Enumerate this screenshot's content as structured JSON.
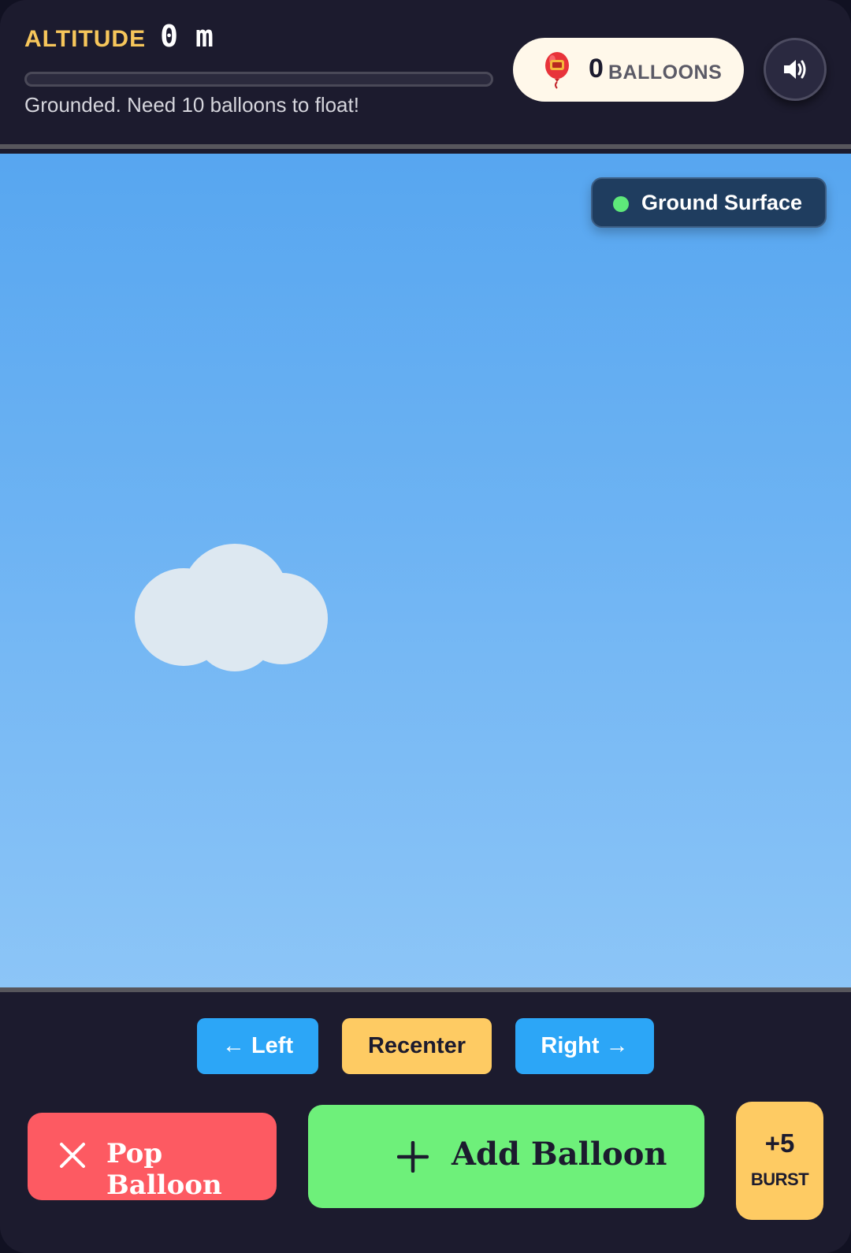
{
  "header": {
    "altitude_label": "ALTITUDE",
    "altitude_value": "0",
    "altitude_unit": "m",
    "altitude_progress": 0,
    "status_text": "Grounded. Need 10 balloons to float!",
    "balloon_count": "0",
    "balloon_count_label": "BALLOONS",
    "balloon_icon": "balloon-icon",
    "sound_icon": "speaker-icon"
  },
  "scene": {
    "zone_label": "Ground Surface",
    "zone_indicator_color": "#5ee87a"
  },
  "controls": {
    "left_label": "← Left",
    "recenter_label": "Recenter",
    "right_label": "Right →",
    "pop_label": "Pop Balloon",
    "add_label": "Add Balloon",
    "burst_amount": "+5",
    "burst_label": "BURST"
  },
  "colors": {
    "accent_gold": "#f6c65b",
    "button_blue": "#2ca6f7",
    "button_yellow": "#fecb63",
    "button_red": "#fd5a62",
    "button_green": "#6ef07a",
    "panel_dark": "#1c1b2e"
  }
}
